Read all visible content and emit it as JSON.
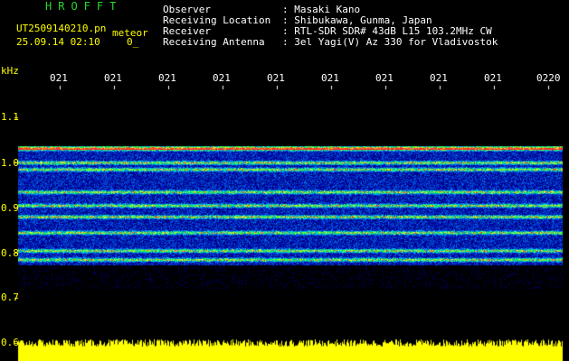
{
  "header": {
    "app_name": "HROFFT",
    "file_name": "UT2509140210.pn",
    "mode": "meteor",
    "date_time": "25.09.14 02:10",
    "counter": "0_",
    "fields": [
      {
        "label": "Observer",
        "value": ": Masaki Kano"
      },
      {
        "label": "Receiving Location",
        "value": ": Shibukawa, Gunma, Japan"
      },
      {
        "label": "Receiver",
        "value": ": RTL-SDR SDR# 43dB L15 103.2MHz CW"
      },
      {
        "label": "Receiving Antenna",
        "value": ": 3el Yagi(V) Az 330 for Vladivostok"
      }
    ]
  },
  "chart_data": {
    "type": "heatmap",
    "ylabel": "kHz",
    "y_ticks": [
      "1.1",
      "1.0",
      "0.9",
      "0.8",
      "0.7",
      "0.6"
    ],
    "y_tick_values": [
      1.1,
      1.0,
      0.9,
      0.8,
      0.7,
      0.6
    ],
    "ylim": [
      0.6,
      1.15
    ],
    "x_ticks": [
      "021",
      "021",
      "021",
      "021",
      "021",
      "021",
      "021",
      "021",
      "021",
      "0220"
    ],
    "signal_band_khz": [
      0.775,
      1.035
    ],
    "strong_lines_khz": [
      1.03,
      1.0,
      0.985,
      0.935,
      0.905,
      0.88,
      0.845,
      0.805,
      0.785
    ],
    "colors": {
      "background": "#000000",
      "low": "#0000a0",
      "mid": "#00c0ff",
      "high": "#ff2020",
      "noise_bar": "#ffff00"
    }
  }
}
